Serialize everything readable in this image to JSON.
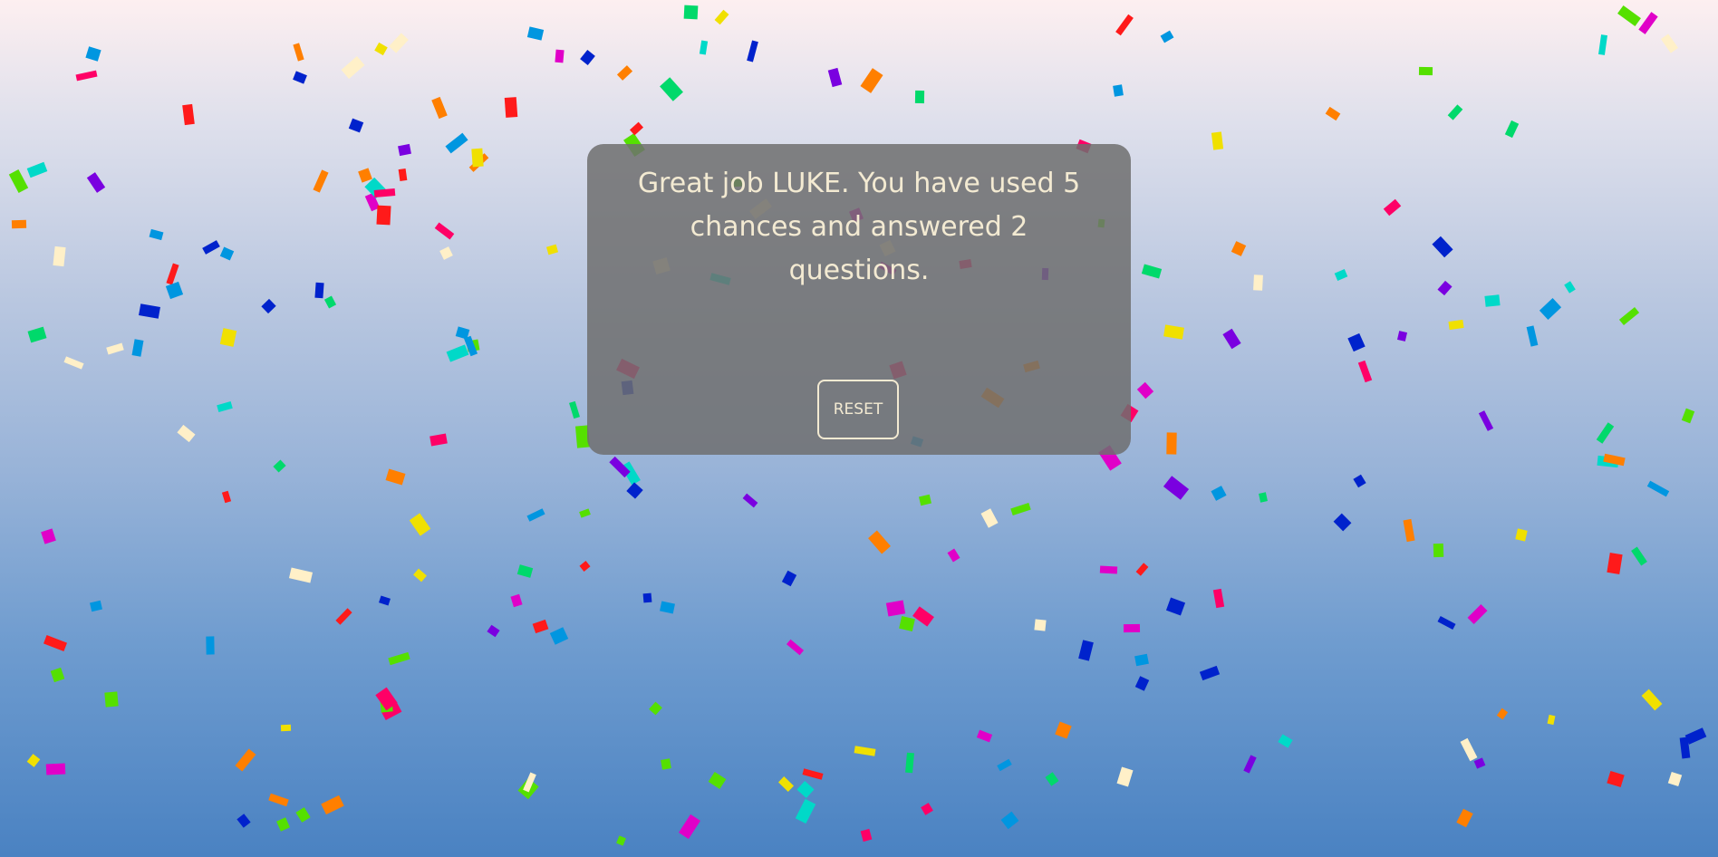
{
  "modal": {
    "message": "Great job LUKE. You have used 5 chances and answered 2 questions.",
    "reset_label": "RESET"
  },
  "colors": {
    "gradient_top": "#fdeff0",
    "gradient_bottom": "#4a82c2",
    "modal_background": "#6e6e6e",
    "modal_text": "#f3ead2",
    "confetti_palette": [
      "#ff1a1a",
      "#ff7f00",
      "#f0e000",
      "#55e000",
      "#00d96b",
      "#00d9c8",
      "#0096e0",
      "#0022cc",
      "#7a00e0",
      "#e000c8",
      "#ff0066",
      "#fff0c8"
    ]
  }
}
